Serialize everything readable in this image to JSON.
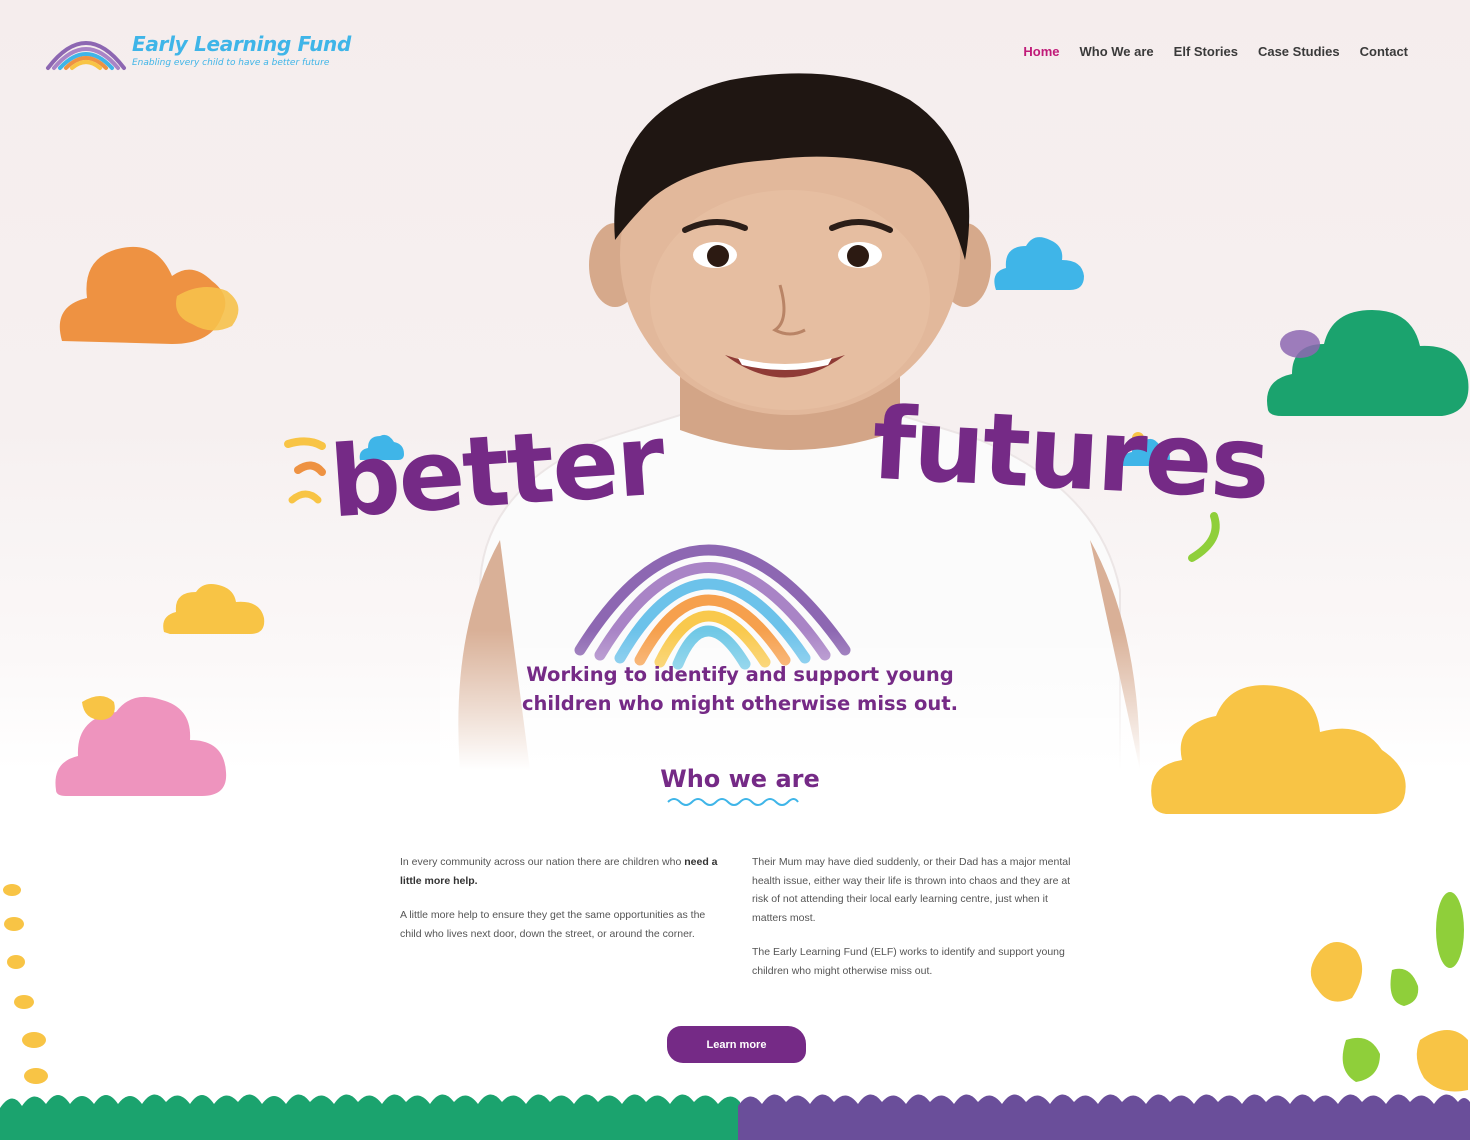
{
  "brand": {
    "name": "Early Learning Fund",
    "tagline": "Enabling every child to have a better future"
  },
  "nav": [
    {
      "label": "Home",
      "active": true
    },
    {
      "label": "Who We are",
      "active": false
    },
    {
      "label": "Elf Stories",
      "active": false
    },
    {
      "label": "Case Studies",
      "active": false
    },
    {
      "label": "Contact",
      "active": false
    }
  ],
  "hero": {
    "word1": "better",
    "word2": "futures",
    "subtitle_line1": "Working to identify and support young",
    "subtitle_line2": "children who might otherwise miss out."
  },
  "who": {
    "title": "Who we are",
    "left_p1_text": "In every community across our nation there are children who",
    "left_p1_bold": "need a little more help.",
    "left_p2": "A little more help to ensure they get the same opportunities as the child who lives next door, down the street, or around the corner.",
    "right_p1": "Their Mum may have died suddenly, or their Dad has a major mental health issue, either way their life is thrown into chaos and they are at risk of not attending their local early learning centre, just when it matters most.",
    "right_p2": "The Early Learning Fund (ELF) works to identify and support young children who might otherwise miss out.",
    "cta_label": "Learn more"
  },
  "colors": {
    "purple": "#752a86",
    "pink_active": "#c01b79",
    "sky": "#3fb5e8",
    "orange": "#ee9242",
    "yellow": "#f8c445",
    "green": "#1ba36e",
    "pink": "#ee94be",
    "lavender": "#6a4e9a"
  }
}
